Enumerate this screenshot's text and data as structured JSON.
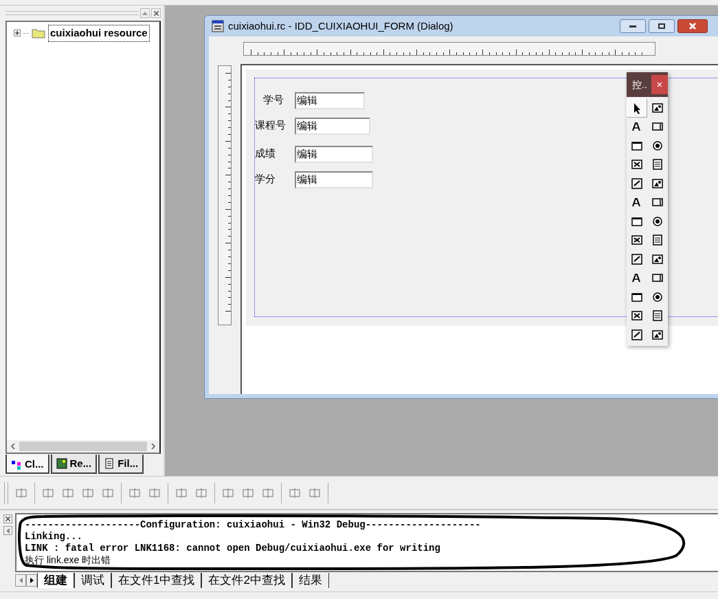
{
  "workspace": {
    "tree": [
      {
        "label": "cuixiaohui resource",
        "expanded": false,
        "selected": true
      }
    ],
    "tabs": [
      {
        "label": "Cl...",
        "selected": true
      },
      {
        "label": "Re...",
        "selected": false
      },
      {
        "label": "Fil...",
        "selected": false
      }
    ]
  },
  "editor_window": {
    "title": "cuixiaohui.rc - IDD_CUIXIAOHUI_FORM (Dialog)",
    "fields": [
      {
        "label": "学号",
        "value": "编辑"
      },
      {
        "label": "课程号",
        "value": "编辑"
      },
      {
        "label": "成绩",
        "value": "编辑"
      },
      {
        "label": "学分",
        "value": "编辑"
      }
    ]
  },
  "controls_palette": {
    "title": "控..",
    "close": "×",
    "tools": [
      {
        "selected": true
      },
      {
        "selected": false
      },
      {
        "selected": false
      },
      {
        "selected": false
      },
      {
        "selected": false
      },
      {
        "selected": false
      },
      {
        "selected": false
      },
      {
        "selected": false
      },
      {
        "selected": false
      },
      {
        "selected": false
      },
      {
        "selected": false
      },
      {
        "selected": false
      },
      {
        "selected": false
      },
      {
        "selected": false
      },
      {
        "selected": false
      },
      {
        "selected": false
      },
      {
        "selected": false
      },
      {
        "selected": false
      },
      {
        "selected": false
      },
      {
        "selected": false
      },
      {
        "selected": false
      },
      {
        "selected": false
      },
      {
        "selected": false
      },
      {
        "selected": false
      },
      {
        "selected": false
      },
      {
        "selected": false
      }
    ]
  },
  "output": {
    "lines": [
      "--------------------Configuration: cuixiaohui - Win32 Debug--------------------",
      "Linking...",
      "LINK : fatal error LNK1168: cannot open Debug/cuixiaohui.exe for writing",
      "执行 link.exe 时出错"
    ],
    "tabs": [
      {
        "label": "组建",
        "selected": true
      },
      {
        "label": "调试",
        "selected": false
      },
      {
        "label": "在文件1中查找",
        "selected": false
      },
      {
        "label": "在文件2中查找",
        "selected": false
      },
      {
        "label": "结果",
        "selected": false
      }
    ]
  }
}
